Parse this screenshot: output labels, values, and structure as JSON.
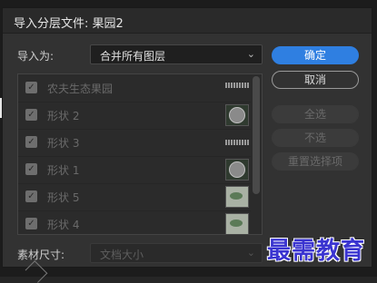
{
  "dialog": {
    "title": "导入分层文件: 果园2"
  },
  "import": {
    "label": "导入为:",
    "value": "合并所有图层"
  },
  "layers": [
    {
      "name": "农夫生态果园",
      "checked": true
    },
    {
      "name": "形状 2",
      "checked": true
    },
    {
      "name": "形状 3",
      "checked": true
    },
    {
      "name": "形状 1",
      "checked": true
    },
    {
      "name": "形状 5",
      "checked": true
    },
    {
      "name": "形状 4",
      "checked": true
    }
  ],
  "buttons": {
    "ok": "确定",
    "cancel": "取消",
    "select_all": "全选",
    "select_none": "不选",
    "reset": "重置选择项"
  },
  "footage": {
    "label": "素材尺寸:",
    "value": "文档大小"
  },
  "watermark": "最需教育",
  "colors": {
    "accent": "#2f7fe1",
    "watermark": "#3a34d0"
  },
  "icons": {
    "checkbox": "checkmark-icon",
    "dropdown": "chevron-down-icon"
  }
}
